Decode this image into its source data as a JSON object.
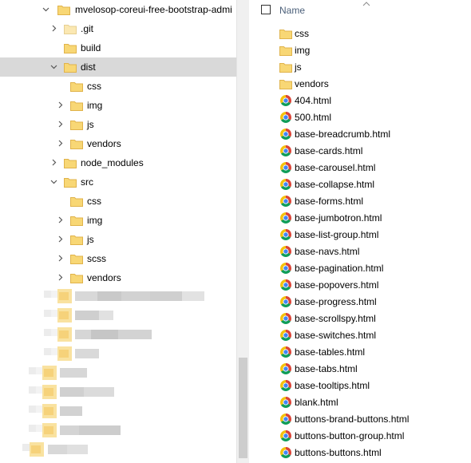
{
  "tree": {
    "items": [
      {
        "label": "mvelosop-coreui-free-bootstrap-admi",
        "chevron": "down",
        "selected": false
      },
      {
        "label": ".git",
        "chevron": "right",
        "selected": false
      },
      {
        "label": "build",
        "chevron": "none",
        "selected": false
      },
      {
        "label": "dist",
        "chevron": "down",
        "selected": true
      },
      {
        "label": "css",
        "chevron": "none",
        "selected": false
      },
      {
        "label": "img",
        "chevron": "right",
        "selected": false
      },
      {
        "label": "js",
        "chevron": "right",
        "selected": false
      },
      {
        "label": "vendors",
        "chevron": "right",
        "selected": false
      },
      {
        "label": "node_modules",
        "chevron": "right",
        "selected": false
      },
      {
        "label": "src",
        "chevron": "down",
        "selected": false
      },
      {
        "label": "css",
        "chevron": "none",
        "selected": false
      },
      {
        "label": "img",
        "chevron": "right",
        "selected": false
      },
      {
        "label": "js",
        "chevron": "right",
        "selected": false
      },
      {
        "label": "scss",
        "chevron": "right",
        "selected": false
      },
      {
        "label": "vendors",
        "chevron": "right",
        "selected": false
      }
    ]
  },
  "files": {
    "header": {
      "name_label": "Name"
    },
    "items": [
      {
        "label": "css",
        "kind": "folder"
      },
      {
        "label": "img",
        "kind": "folder"
      },
      {
        "label": "js",
        "kind": "folder"
      },
      {
        "label": "vendors",
        "kind": "folder"
      },
      {
        "label": "404.html",
        "kind": "html"
      },
      {
        "label": "500.html",
        "kind": "html"
      },
      {
        "label": "base-breadcrumb.html",
        "kind": "html"
      },
      {
        "label": "base-cards.html",
        "kind": "html"
      },
      {
        "label": "base-carousel.html",
        "kind": "html"
      },
      {
        "label": "base-collapse.html",
        "kind": "html"
      },
      {
        "label": "base-forms.html",
        "kind": "html"
      },
      {
        "label": "base-jumbotron.html",
        "kind": "html"
      },
      {
        "label": "base-list-group.html",
        "kind": "html"
      },
      {
        "label": "base-navs.html",
        "kind": "html"
      },
      {
        "label": "base-pagination.html",
        "kind": "html"
      },
      {
        "label": "base-popovers.html",
        "kind": "html"
      },
      {
        "label": "base-progress.html",
        "kind": "html"
      },
      {
        "label": "base-scrollspy.html",
        "kind": "html"
      },
      {
        "label": "base-switches.html",
        "kind": "html"
      },
      {
        "label": "base-tables.html",
        "kind": "html"
      },
      {
        "label": "base-tabs.html",
        "kind": "html"
      },
      {
        "label": "base-tooltips.html",
        "kind": "html"
      },
      {
        "label": "blank.html",
        "kind": "html"
      },
      {
        "label": "buttons-brand-buttons.html",
        "kind": "html"
      },
      {
        "label": "buttons-button-group.html",
        "kind": "html"
      },
      {
        "label": "buttons-buttons.html",
        "kind": "html"
      }
    ]
  },
  "colors": {
    "folder": "#f8d775",
    "folder_dark": "#e0b34b",
    "selection": "#d9d9d9",
    "header_text": "#4c607a",
    "chrome_red": "#db4437",
    "chrome_yellow": "#f4c20d",
    "chrome_green": "#0f9d58",
    "chrome_blue": "#4285f4"
  }
}
